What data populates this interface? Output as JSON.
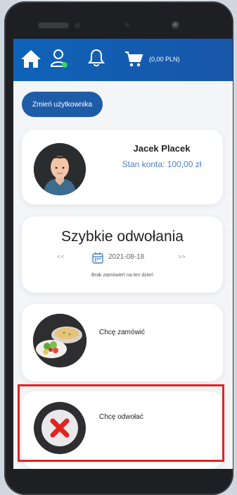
{
  "header": {
    "icons": [
      "home-icon",
      "user-icon",
      "bell-icon",
      "cart-icon"
    ],
    "cart_total": "(0,00 PLN)"
  },
  "switch_user_label": "Zmień użytkownika",
  "profile": {
    "name": "Jacek Placek",
    "balance": "Stan konta: 100,00 zł"
  },
  "quick_cancel": {
    "title": "Szybkie odwołania",
    "prev": "<<",
    "date": "2021-08-18",
    "next": ">>",
    "message": "Brak zamówień na ten dzień"
  },
  "actions": {
    "order_label": "Chcę zamówić",
    "cancel_label": "Chcę odwołać"
  },
  "colors": {
    "header": "#1856a8",
    "button": "#1f5ca8",
    "balance_text": "#4a7fc7",
    "highlight": "#e02424",
    "cancel_x": "#e02424"
  }
}
